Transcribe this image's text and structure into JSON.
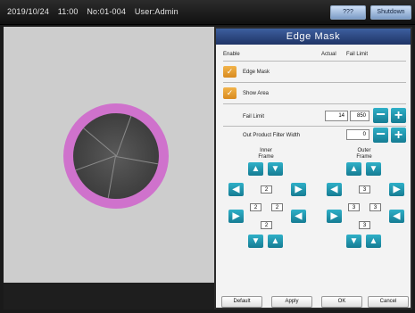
{
  "topbar": {
    "date": "2019/10/24",
    "time": "11:00",
    "no": "No:01-004",
    "user": "User:Admin",
    "btn1": "???",
    "btn2": "Shutdown"
  },
  "panel": {
    "title": "Edge Mask",
    "headers": {
      "enable": "Enable",
      "actual": "Actual",
      "fail_limit": "Fail Limit"
    },
    "edge_mask": {
      "label": "Edge Mask",
      "checked": true
    },
    "show_area": {
      "label": "Show Area",
      "checked": true
    },
    "fail_limit": {
      "label": "Fail Limit",
      "actual": "14",
      "value": "850"
    },
    "out_product_filter_width": {
      "label": "Out Product Filter Width",
      "value": "0"
    },
    "inner_frame": {
      "label_line1": "Inner",
      "label_line2": "Frame",
      "top": "2",
      "left": "2",
      "right": "2",
      "bottom": "2"
    },
    "outer_frame": {
      "label_line1": "Outer",
      "label_line2": "Frame",
      "top": "3",
      "left": "3",
      "right": "3",
      "bottom": "3"
    },
    "footer": {
      "default": "Default",
      "apply": "Apply",
      "ok": "OK",
      "cancel": "Cancel"
    }
  },
  "colors": {
    "title_bar": "#2b4a85",
    "checkbox": "#e39a2d",
    "teal_button": "#1f97ae",
    "ring": "#cf72cc"
  },
  "icons": {
    "minus": "−",
    "plus": "+",
    "up": "▲",
    "down": "▼",
    "left": "◀",
    "right": "▶",
    "check": "✓"
  }
}
